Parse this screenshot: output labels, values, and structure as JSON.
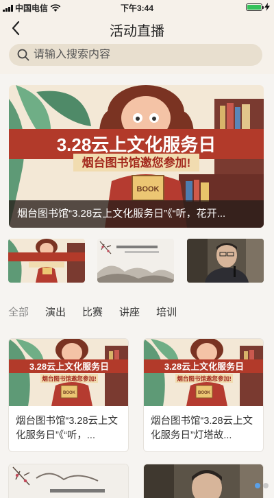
{
  "status": {
    "carrier": "中国电信",
    "time": "下午3:44",
    "battery_color": "#35c25b"
  },
  "nav": {
    "back_icon": "chevron-left-icon",
    "title": "活动直播"
  },
  "search": {
    "placeholder": "请输入搜索内容",
    "icon": "search-icon"
  },
  "banner": {
    "poster_title": "3.28云上文化服务日",
    "poster_subtitle": "烟台图书馆邀您参加!",
    "poster_book": "BOOK",
    "caption": "烟台图书馆“3.28云上文化服务日”《“听，花开..."
  },
  "thumbs": [
    {
      "name": "cultural-day-poster"
    },
    {
      "name": "ink-painting-poster",
      "text": "念春书法 翰墨留韵"
    },
    {
      "name": "speaker-photo"
    }
  ],
  "tabs": [
    {
      "label": "全部",
      "active": true
    },
    {
      "label": "演出",
      "active": false
    },
    {
      "label": "比赛",
      "active": false
    },
    {
      "label": "讲座",
      "active": false
    },
    {
      "label": "培训",
      "active": false
    }
  ],
  "cards": [
    {
      "title": "烟台图书馆“3.28云上文化服务日”《“听，..."
    },
    {
      "title": "烟台图书馆“3.28云上文化服务日”灯塔故..."
    }
  ],
  "accent": "#5aa0e8"
}
